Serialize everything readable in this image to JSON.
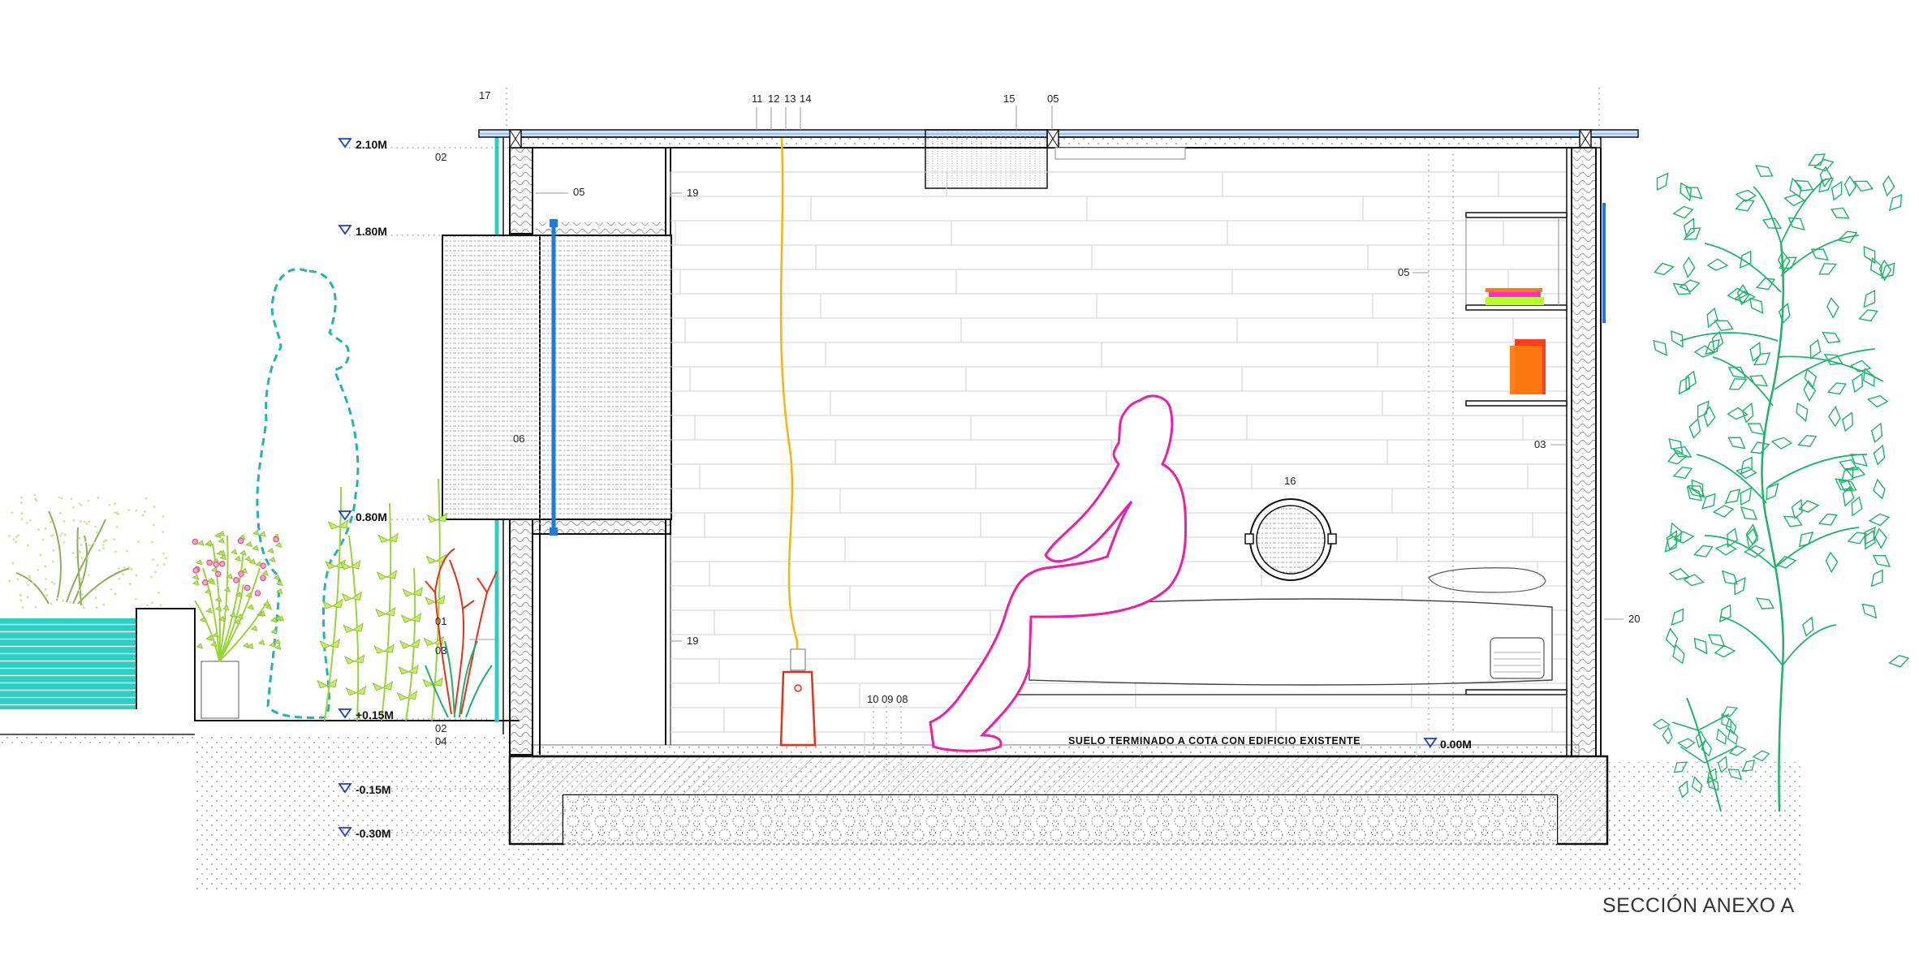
{
  "drawing": {
    "title": "SECCIÓN ANEXO A",
    "floor_note": "SUELO TERMINADO A COTA CON EDIFICIO EXISTENTE"
  },
  "levels": {
    "l1": "2.10M",
    "l2": "1.80M",
    "l3": "0.80M",
    "l4": "+0.15M",
    "l5": "-0.15M",
    "l6": "-0.30M",
    "l7": "0.00M"
  },
  "callouts": {
    "c17": "17",
    "c11": "11",
    "c12": "12",
    "c13": "13",
    "c14": "14",
    "c15": "15",
    "c05_top": "05",
    "c02_top": "02",
    "c05_wall": "05",
    "c19_top": "19",
    "c05_right": "05",
    "c06": "06",
    "c16": "16",
    "c03_right": "03",
    "c01": "01",
    "c03_left": "03",
    "c19_bottom": "19",
    "c20": "20",
    "c02_bottom": "02",
    "c04": "04",
    "c10": "10",
    "c09": "09",
    "c08": "08"
  },
  "colors": {
    "water": "#2ad0c4",
    "window_frame": "#1f7ae0",
    "figure_outline": "#ee1fa5",
    "lamp_cord": "#f5b50f",
    "lamp_shade": "#e8301c",
    "plants_left": "#9bd43a",
    "flowers": "#e64f8f",
    "tree": "#1cb36b",
    "silhouette_dash": "#22b4b0",
    "level_marker": "#1a3fd1",
    "book_orange": "#ff7a10",
    "book_red": "#ff3c1e",
    "book_magenta": "#ff2fd0",
    "book_lime": "#b6ff2a"
  }
}
